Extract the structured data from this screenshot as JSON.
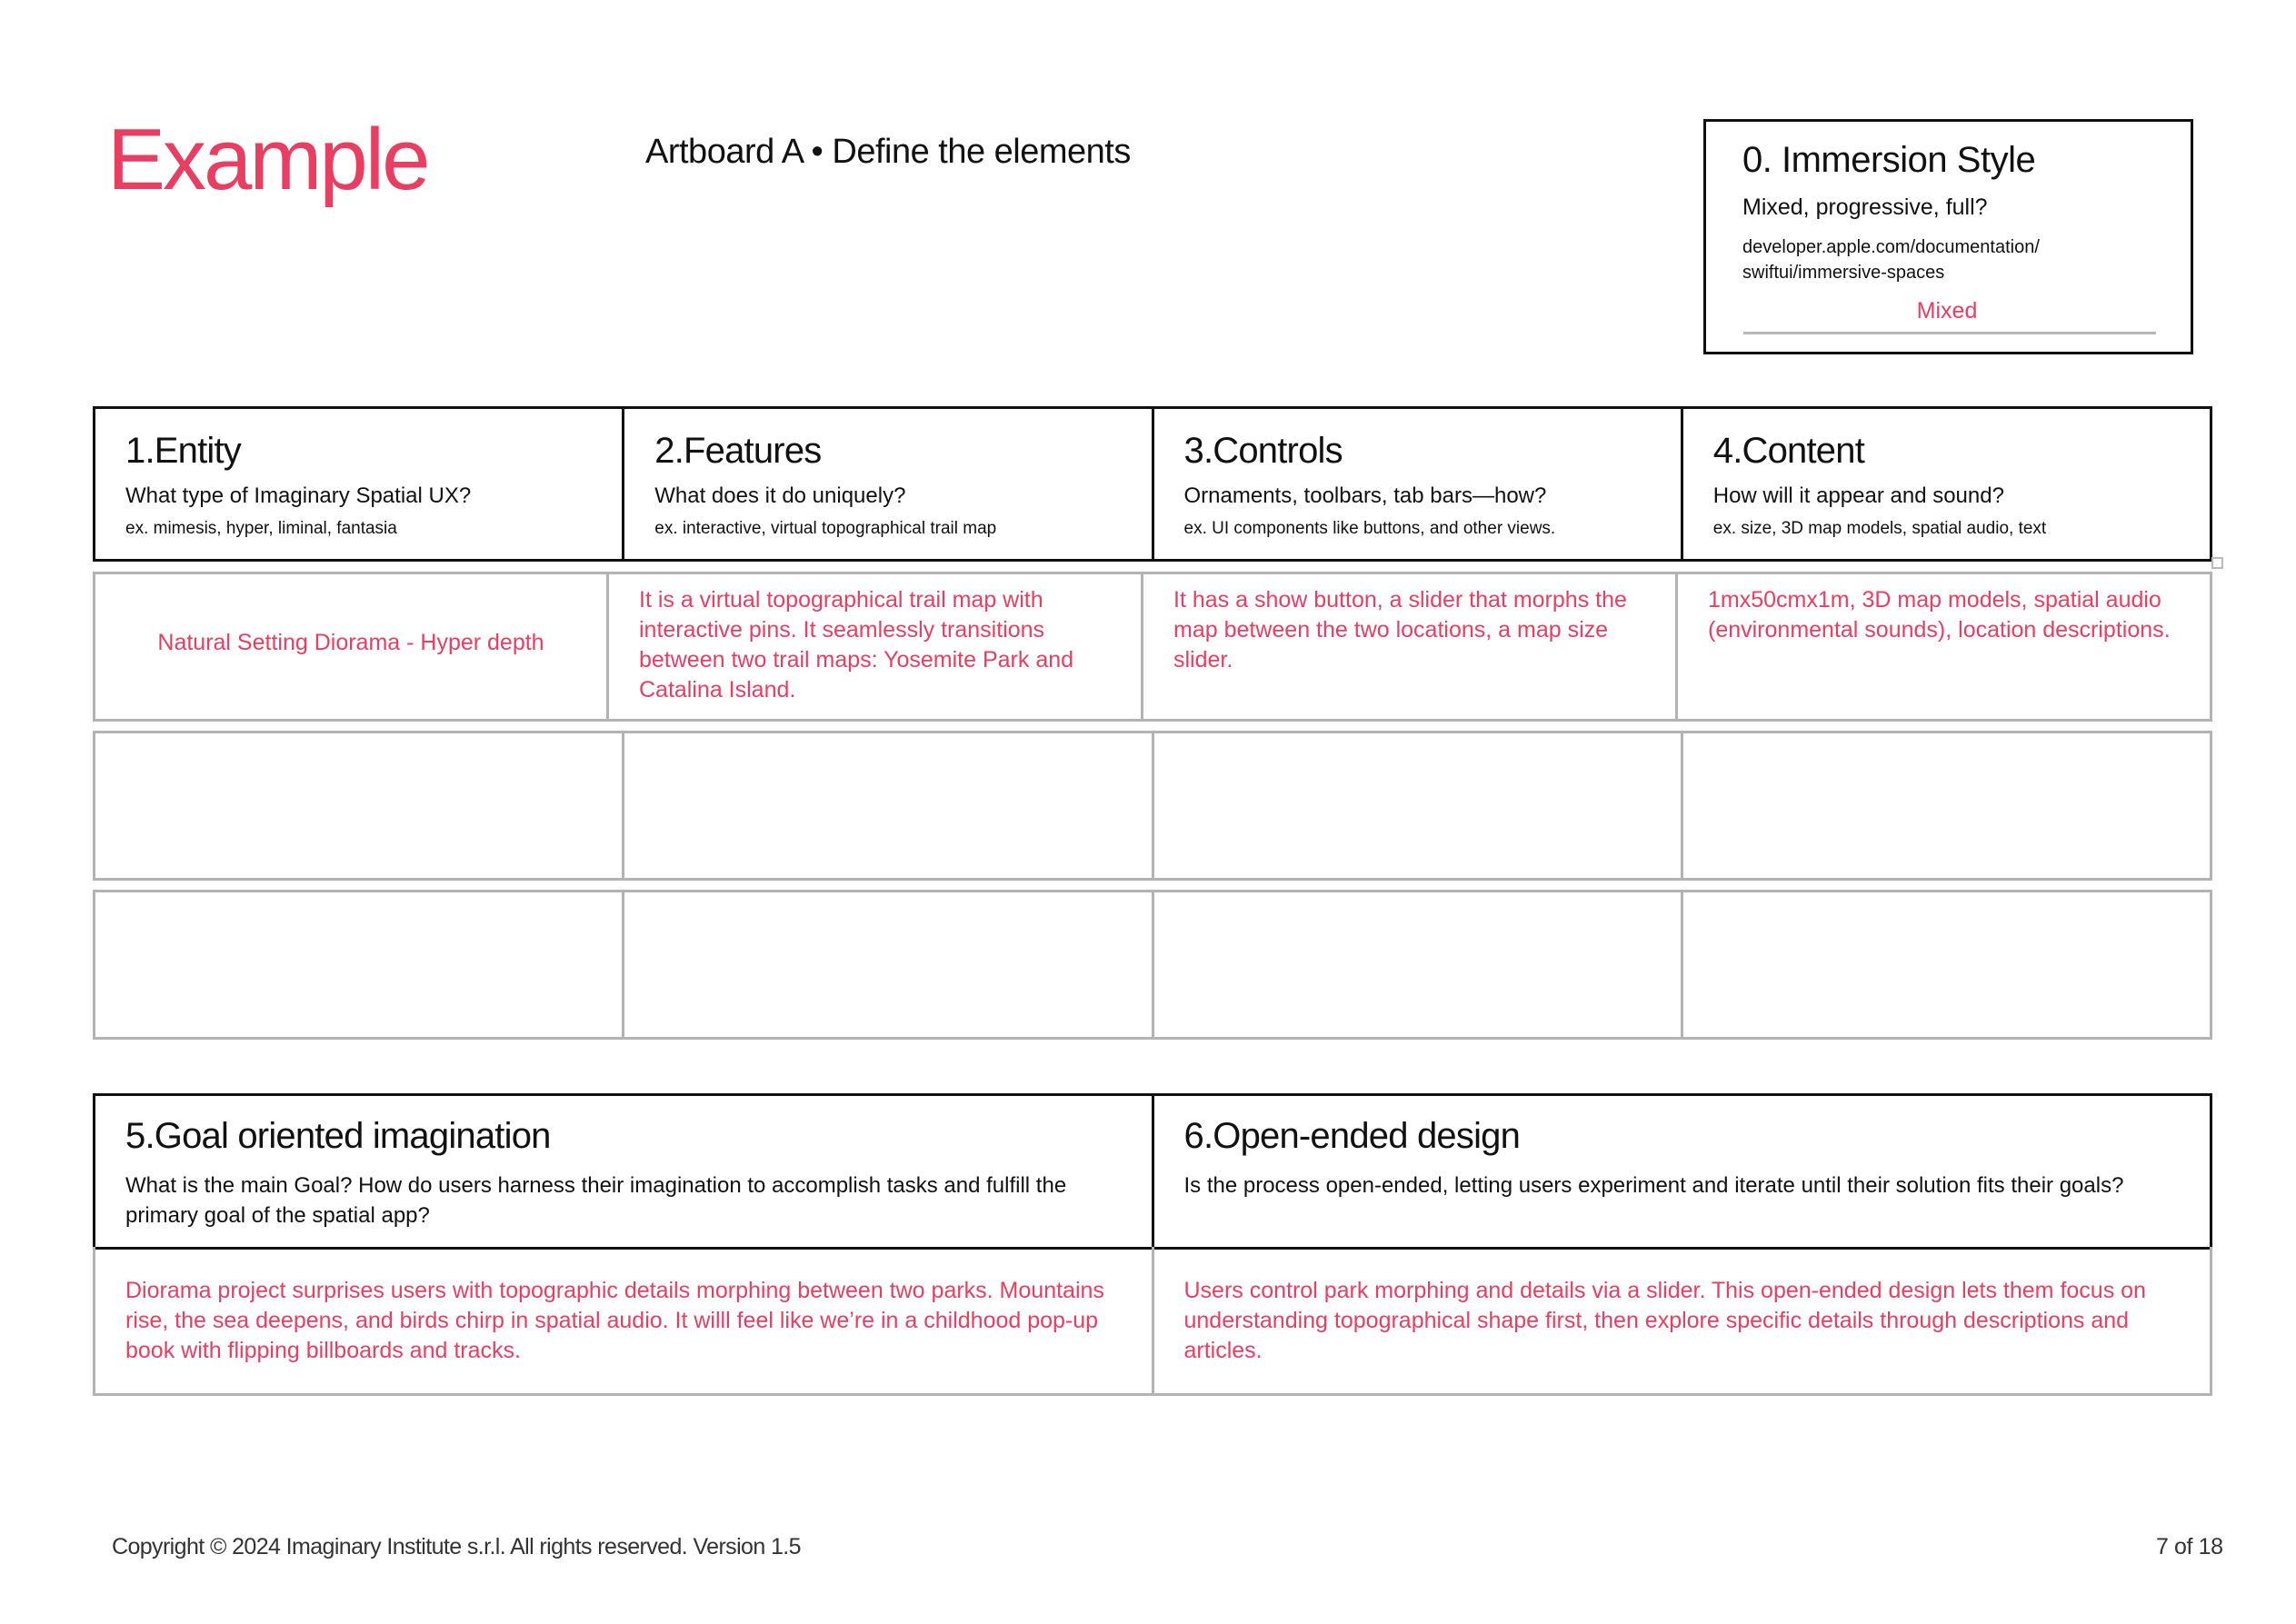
{
  "theme": {
    "accent": "#E83E62",
    "text": "#111111",
    "grid_border": "#B3B3B3"
  },
  "header": {
    "page_label": "Example",
    "artboard_title": "Artboard A • Define the elements"
  },
  "immersion": {
    "title": "0. Immersion Style",
    "question": "Mixed, progressive, full?",
    "reference": "developer.apple.com/documentation/ swiftui/immersive-spaces",
    "answer": "Mixed"
  },
  "columns": [
    {
      "title": "1.Entity",
      "question": "What type of Imaginary Spatial UX?",
      "example": "ex. mimesis, hyper, liminal, fantasia"
    },
    {
      "title": "2.Features",
      "question": "What does it do uniquely?",
      "example": "ex. interactive, virtual topographical trail map"
    },
    {
      "title": "3.Controls",
      "question": "Ornaments, toolbars, tab bars—how?",
      "example": "ex. UI components like buttons, and other views."
    },
    {
      "title": "4.Content",
      "question": "How will it appear and sound?",
      "example": "ex. size, 3D map models, spatial audio, text"
    }
  ],
  "rows": [
    [
      "Natural Setting Diorama - Hyper depth",
      "It is a virtual topographical trail map with interactive pins. It seamlessly transitions between two trail maps: Yosemite Park and Catalina Island.",
      "It has a show button, a slider that morphs the map between the two locations, a map size slider.",
      "1mx50cmx1m, 3D map models, spatial audio (environmental sounds), location descriptions."
    ],
    [
      "",
      "",
      "",
      ""
    ],
    [
      "",
      "",
      "",
      ""
    ]
  ],
  "bottom": [
    {
      "title": "5.Goal oriented imagination",
      "question": "What is the main Goal? How do users harness their imagination to accomplish tasks and fulfill the primary goal of the spatial app?",
      "answer": "Diorama project surprises users with topographic details morphing between two parks. Mountains rise, the sea deepens, and birds chirp in spatial audio. It willl feel like we’re in a childhood pop-up book with flipping billboards and tracks."
    },
    {
      "title": "6.Open-ended design",
      "question": "Is the process open-ended, letting users experiment and iterate until their solution fits their goals?",
      "answer": "Users control park morphing and details via a slider. This open-ended design lets them focus on understanding topographical shape first, then explore specific details through descriptions and articles."
    }
  ],
  "footer": {
    "copyright": "Copyright © 2024 Imaginary Institute s.r.l. All rights reserved. Version 1.5",
    "page_indicator": "7 of 18"
  }
}
